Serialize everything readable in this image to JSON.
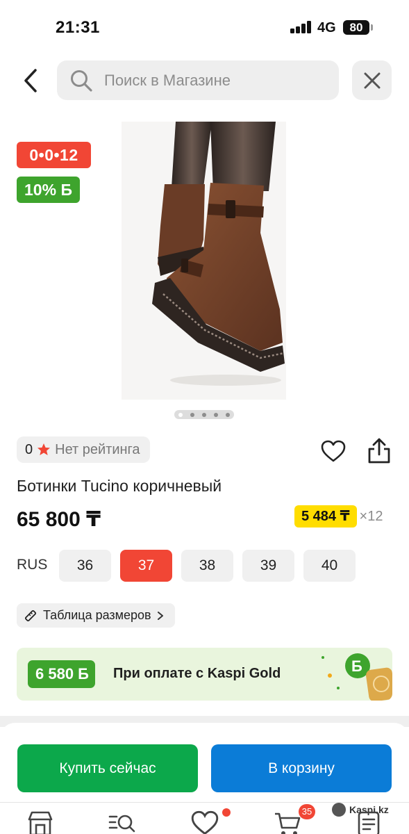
{
  "status_bar": {
    "time": "21:31",
    "network": "4G",
    "battery": "80"
  },
  "search": {
    "placeholder": "Поиск в Магазине"
  },
  "badges": {
    "timer": "0•0•12",
    "bonus": "10% Б"
  },
  "gallery": {
    "slide_count": 5,
    "active_slide": 1
  },
  "rating": {
    "count": "0",
    "label": "Нет рейтинга"
  },
  "product": {
    "title": "Ботинки Tucino коричневый",
    "price": "65 800 ₸",
    "installment_amount": "5 484 ₸",
    "installment_times": "×12"
  },
  "sizes": {
    "system": "RUS",
    "options": [
      "36",
      "37",
      "38",
      "39",
      "40"
    ],
    "selected": "37"
  },
  "size_table_label": "Таблица размеров",
  "kaspi_gold": {
    "bonus": "6 580 Б",
    "text": "При оплате с Kaspi Gold"
  },
  "actions": {
    "buy_now": "Купить сейчас",
    "add_to_cart": "В корзину"
  },
  "bottom_nav": {
    "cart_count": "35",
    "brand": "Kaspi.kz"
  },
  "colors": {
    "red": "#f14635",
    "green": "#3ea42d",
    "buy": "#0ca84b",
    "cart": "#0b7cd7",
    "installment": "#ffdd00"
  }
}
